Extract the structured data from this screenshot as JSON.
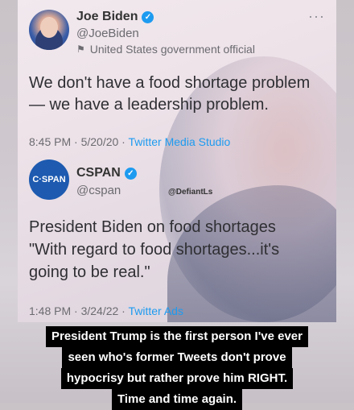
{
  "tweets": [
    {
      "name": "Joe Biden",
      "handle": "@JoeBiden",
      "label": "United States government official",
      "text": [
        "We don't have a food shortage problem",
        "— we have a leadership problem."
      ],
      "time": "8:45 PM · 5/20/20 · ",
      "source": "Twitter Media Studio"
    },
    {
      "name": "CSPAN",
      "avatar_text": "C·SPAN",
      "handle": "@cspan",
      "text": [
        "President Biden on food shortages",
        "\"With regard to food shortages...it's",
        "going to be real.\""
      ],
      "time": "1:48 PM · 3/24/22 · ",
      "source": "Twitter Ads"
    }
  ],
  "watermark": "@DefiantLs",
  "more": "···",
  "caption": [
    "President Trump is the first person I've ever",
    "seen who's former Tweets don't prove",
    "hypocrisy but rather prove him RIGHT.",
    "Time and time again."
  ]
}
